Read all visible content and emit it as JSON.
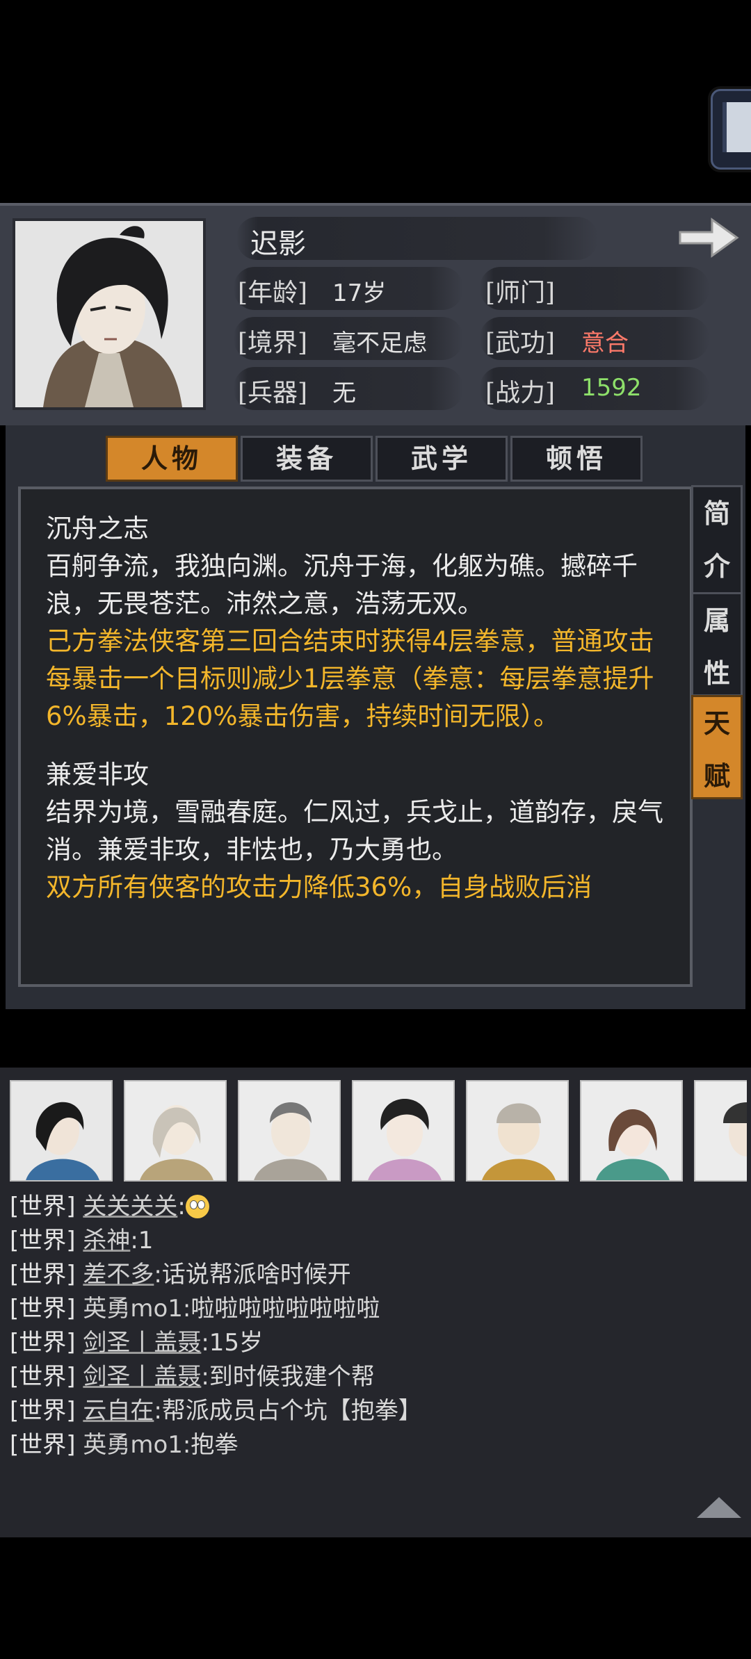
{
  "character": {
    "name": "迟影",
    "age_label": "[年龄]",
    "age": "17岁",
    "sect_label": "[师门]",
    "sect": "",
    "realm_label": "[境界]",
    "realm": "毫不足虑",
    "martial_label": "[武功]",
    "martial": "意合",
    "weapon_label": "[兵器]",
    "weapon": "无",
    "power_label": "[战力]",
    "power": "1592",
    "colors": {
      "power": "#8ee06a",
      "martial": "#ff7a6a",
      "highlight": "#f3b62b",
      "active_tab": "#d4872a"
    }
  },
  "tabs": [
    "人物",
    "装备",
    "武学",
    "顿悟"
  ],
  "side_tabs": [
    {
      "chars": [
        "简",
        "介"
      ]
    },
    {
      "chars": [
        "属",
        "性"
      ]
    },
    {
      "chars": [
        "天",
        "赋"
      ]
    }
  ],
  "talents": [
    {
      "title": "沉舟之志",
      "desc": "百舸争流，我独向渊。沉舟于海，化躯为礁。撼碎千浪，无畏苍茫。沛然之意，浩荡无双。",
      "effect": "己方拳法侠客第三回合结束时获得4层拳意，普通攻击每暴击一个目标则减少1层拳意（拳意：每层拳意提升6%暴击，120%暴击伤害，持续时间无限）。"
    },
    {
      "title": "兼爱非攻",
      "desc": "结界为境，雪融春庭。仁风过，兵戈止，道韵存，戾气消。兼爱非攻，非怯也，乃大勇也。",
      "effect": "双方所有侠客的攻击力降低36%，自身战败后消"
    }
  ],
  "chat": [
    {
      "channel": "[世界]",
      "user": "关关关关",
      "msg": ":",
      "emoji": "roll-eyes"
    },
    {
      "channel": "[世界]",
      "user": "杀神",
      "msg": ":1"
    },
    {
      "channel": "[世界]",
      "user": "差不多",
      "msg": ":话说帮派啥时候开"
    },
    {
      "channel": "[世界]",
      "user": "英勇mo1",
      "msg": ":啦啦啦啦啦啦啦啦"
    },
    {
      "channel": "[世界]",
      "user": "剑圣丨盖聂",
      "msg": ":15岁"
    },
    {
      "channel": "[世界]",
      "user": "剑圣丨盖聂",
      "msg": ":到时候我建个帮"
    },
    {
      "channel": "[世界]",
      "user": "云自在",
      "msg": ":帮派成员占个坑【抱拳】"
    },
    {
      "channel": "[世界]",
      "user": "英勇mo1",
      "msg": ":抱拳"
    }
  ]
}
